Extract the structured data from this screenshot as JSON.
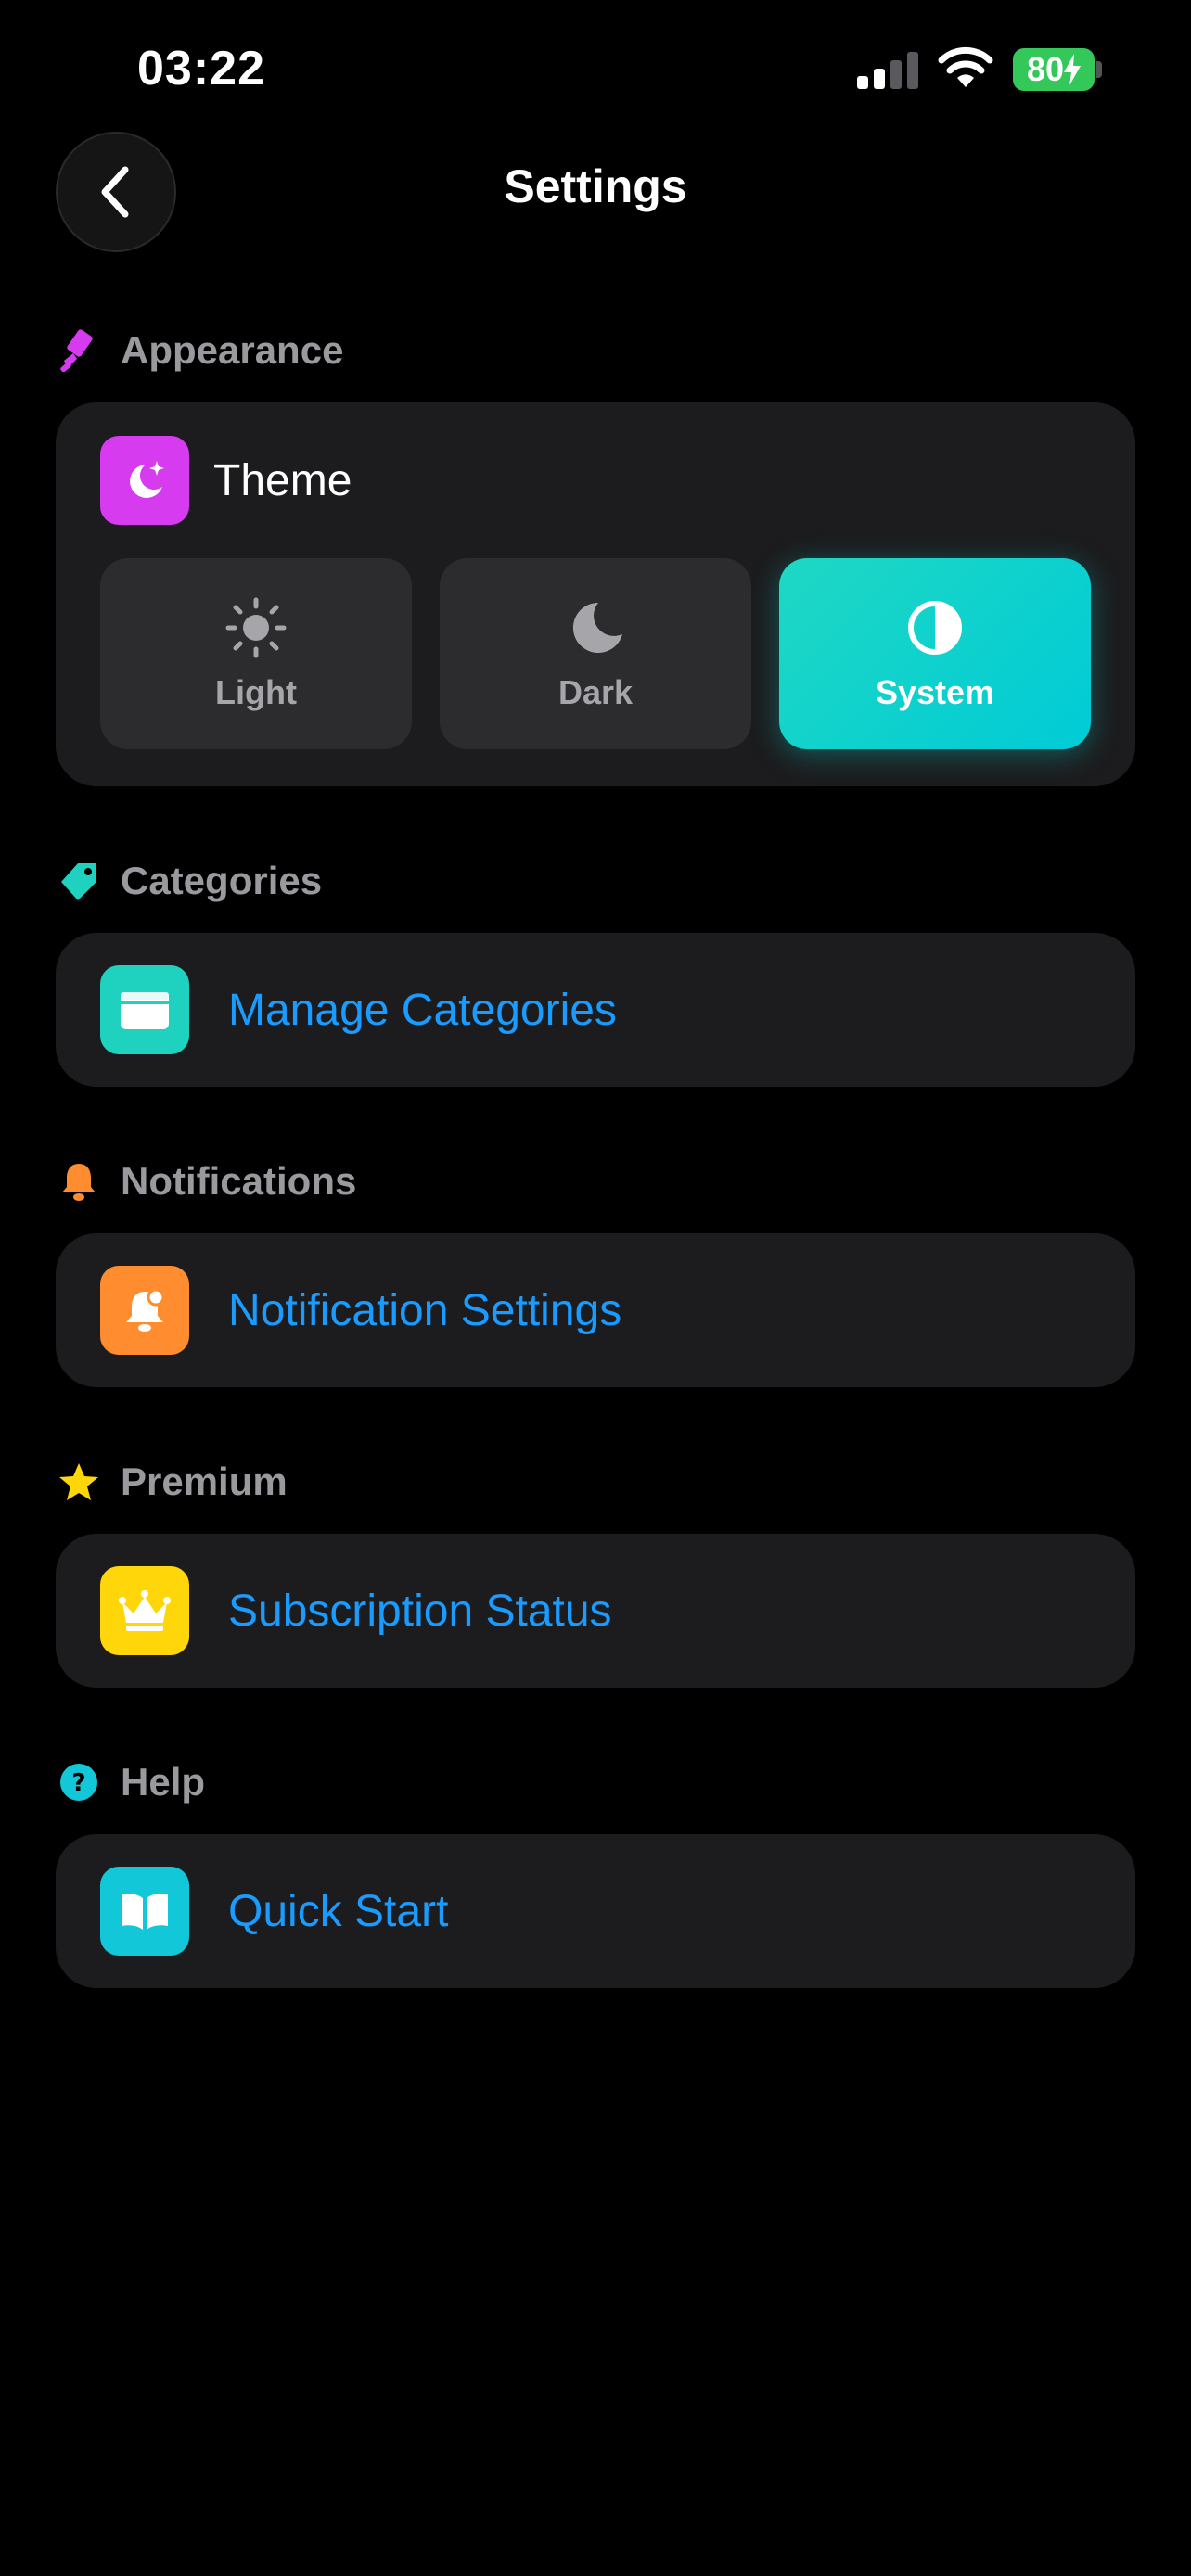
{
  "status_bar": {
    "time": "03:22",
    "battery": "80"
  },
  "header": {
    "title": "Settings"
  },
  "sections": {
    "appearance": {
      "label": "Appearance",
      "theme_label": "Theme",
      "options": [
        "Light",
        "Dark",
        "System"
      ],
      "selected": "System"
    },
    "categories": {
      "label": "Categories",
      "row": "Manage Categories"
    },
    "notifications": {
      "label": "Notifications",
      "row": "Notification Settings"
    },
    "premium": {
      "label": "Premium",
      "row": "Subscription Status"
    },
    "help": {
      "label": "Help",
      "row": "Quick Start"
    }
  },
  "colors": {
    "appearance_accent": "#d63bf0",
    "categories_accent": "#1ed2bf",
    "notifications_accent": "#ff8c2e",
    "premium_accent": "#ffd60a",
    "help_accent": "#12c8d8",
    "link_blue": "#1a9bff"
  },
  "icons": {
    "back": "chevron-left-icon",
    "appearance": "paint-brush-icon",
    "theme": "moon-stars-icon",
    "light": "sun-icon",
    "dark": "moon-icon",
    "system": "half-circle-icon",
    "categories": "tag-icon",
    "manage_categories": "folder-icon",
    "notifications": "bell-icon",
    "notification_settings": "bell-badge-icon",
    "premium": "star-icon",
    "subscription": "crown-icon",
    "help": "question-circle-icon",
    "quick_start": "book-icon"
  }
}
